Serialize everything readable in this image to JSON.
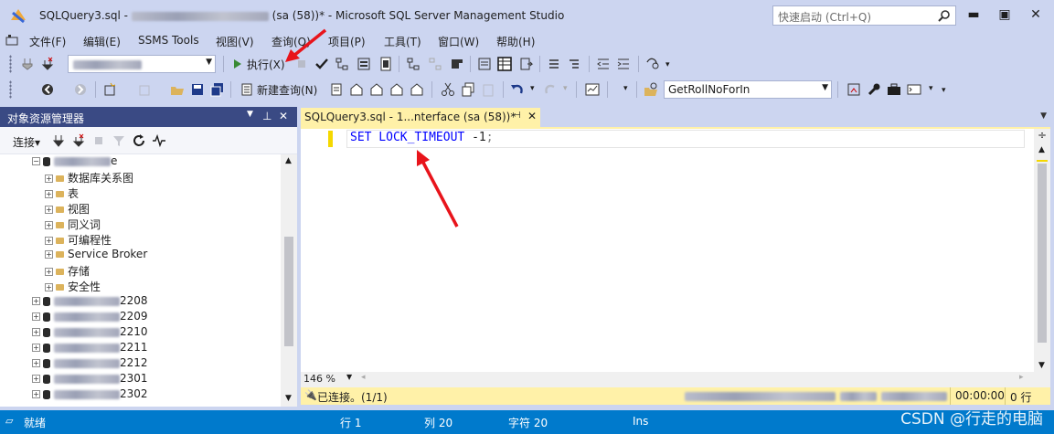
{
  "window": {
    "title_prefix": "SQLQuery3.sql -",
    "title_suffix": "(sa (58))* - Microsoft SQL Server Management Studio",
    "quick_launch_placeholder": "快速启动 (Ctrl+Q)"
  },
  "menu": [
    "文件(F)",
    "编辑(E)",
    "SSMS Tools",
    "视图(V)",
    "查询(Q)",
    "项目(P)",
    "工具(T)",
    "窗口(W)",
    "帮助(H)"
  ],
  "toolbar1": {
    "execute_label": "执行(X)"
  },
  "toolbar2": {
    "new_query_label": "新建查询(N)",
    "procedure_combo_value": "GetRollNoForIn"
  },
  "object_explorer": {
    "title": "对象资源管理器",
    "connect_label": "连接▾",
    "database_root_suffix": "e",
    "folders": [
      "数据库关系图",
      "表",
      "视图",
      "同义词",
      "可编程性",
      "Service Broker",
      "存储",
      "安全性"
    ],
    "database_suffixes": [
      "2208",
      "2209",
      "2210",
      "2211",
      "2212",
      "2301",
      "2302"
    ]
  },
  "editor": {
    "tab_label": "SQLQuery3.sql - 1...nterface (sa (58))*",
    "code_keyword": "SET LOCK_TIMEOUT",
    "code_number": "-1",
    "code_terminator": ";",
    "zoom": "146 %",
    "connection_status": "已连接。(1/1)",
    "elapsed": "00:00:00",
    "row_count": "0 行"
  },
  "statusbar": {
    "ready": "就绪",
    "line": "行 1",
    "column": "列 20",
    "char": "字符 20",
    "mode": "Ins"
  },
  "watermark": "CSDN @行走的电脑",
  "colors": {
    "accent": "#007acc",
    "tab_active": "#fff1a8",
    "arrow": "#e8141b",
    "keyword": "#0000ff"
  }
}
